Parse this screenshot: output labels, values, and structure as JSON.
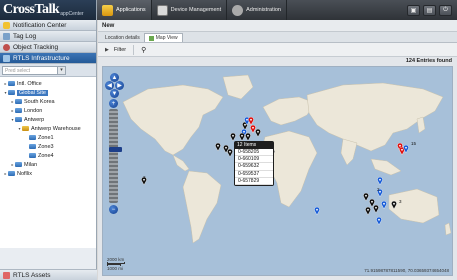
{
  "logo": {
    "brand": "CrossTalk",
    "sub": "appCenter"
  },
  "nav": {
    "notification_center": "Notification Center",
    "tag_log": "Tag Log",
    "object_tracking": "Object Tracking",
    "rtls_infrastructure": "RTLS Infrastructure",
    "rtls_assets": "RTLS Assets"
  },
  "sidebar_filter": {
    "placeholder": "Pred select"
  },
  "tree": [
    {
      "label": "Intl. Office",
      "toggle": "▸",
      "indent": 0
    },
    {
      "label": "Global Site",
      "toggle": "▾",
      "indent": 0,
      "selected": true
    },
    {
      "label": "South Korea",
      "toggle": "▸",
      "indent": 1
    },
    {
      "label": "London",
      "toggle": "▸",
      "indent": 1
    },
    {
      "label": "Antwerp",
      "toggle": "▾",
      "indent": 1
    },
    {
      "label": "Antwerp Warehouse",
      "toggle": "▾",
      "indent": 2,
      "warn": true
    },
    {
      "label": "Zone1",
      "toggle": "",
      "indent": 3
    },
    {
      "label": "Zone3",
      "toggle": "",
      "indent": 3
    },
    {
      "label": "Zone4",
      "toggle": "",
      "indent": 3
    },
    {
      "label": "Milan",
      "toggle": "▸",
      "indent": 1
    },
    {
      "label": "Nofllix",
      "toggle": "▸",
      "indent": 0
    }
  ],
  "topbar": {
    "applications": "Applications",
    "device_management": "Device Management",
    "administration": "Administration",
    "buttons": [
      "▣",
      "▤",
      "⏻"
    ]
  },
  "content": {
    "new_label": "New",
    "tabs": {
      "location_details": "Location details",
      "map_view": "Map View"
    },
    "filter_label": "Filter",
    "entries": "124 Entries found"
  },
  "map": {
    "coords": "71.91598787811590, 70.03659374654048",
    "scale_top": "2000 km",
    "scale_bottom": "1000 mi",
    "zoom_in": "+",
    "zoom_out": "−",
    "pin_labels": [
      "2",
      "4",
      "15",
      "3",
      "2"
    ]
  },
  "popup": {
    "title": "12 Items",
    "items": [
      "0-658205",
      "0-660109",
      "0-659632",
      "0-659537",
      "0-657829"
    ]
  },
  "colors": {
    "accent": "#245a97",
    "topbar": "#3b4046",
    "ocean": "#a7c0d9",
    "land": "#e9e4d6"
  }
}
